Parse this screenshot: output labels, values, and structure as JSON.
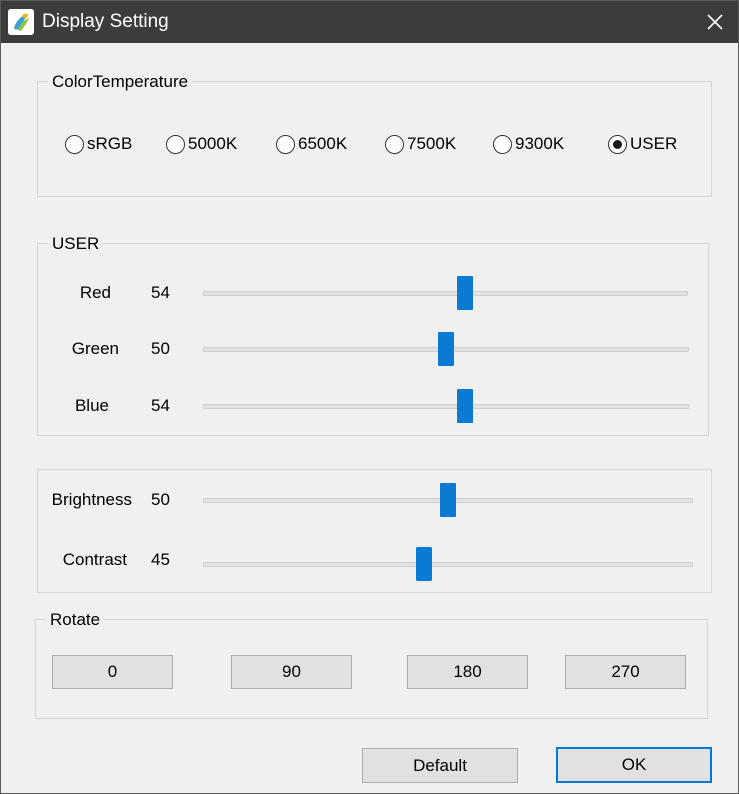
{
  "window": {
    "title": "Display Setting"
  },
  "color_temperature": {
    "legend": "ColorTemperature",
    "options": [
      "sRGB",
      "5000K",
      "6500K",
      "7500K",
      "9300K",
      "USER"
    ],
    "selected": "USER"
  },
  "user": {
    "legend": "USER",
    "sliders": [
      {
        "label": "Red",
        "value": "54",
        "level": 54
      },
      {
        "label": "Green",
        "value": "50",
        "level": 50
      },
      {
        "label": "Blue",
        "value": "54",
        "level": 54
      }
    ]
  },
  "picture": {
    "sliders": [
      {
        "label": "Brightness",
        "value": "50",
        "level": 50
      },
      {
        "label": "Contrast",
        "value": "45",
        "level": 45
      }
    ]
  },
  "rotate": {
    "legend": "Rotate",
    "buttons": [
      "0",
      "90",
      "180",
      "270"
    ]
  },
  "footer": {
    "default_label": "Default",
    "ok_label": "OK"
  },
  "colors": {
    "accent": "#0a7ad3",
    "titlebar": "#3c3c3c",
    "focus_border": "#0078d7"
  }
}
